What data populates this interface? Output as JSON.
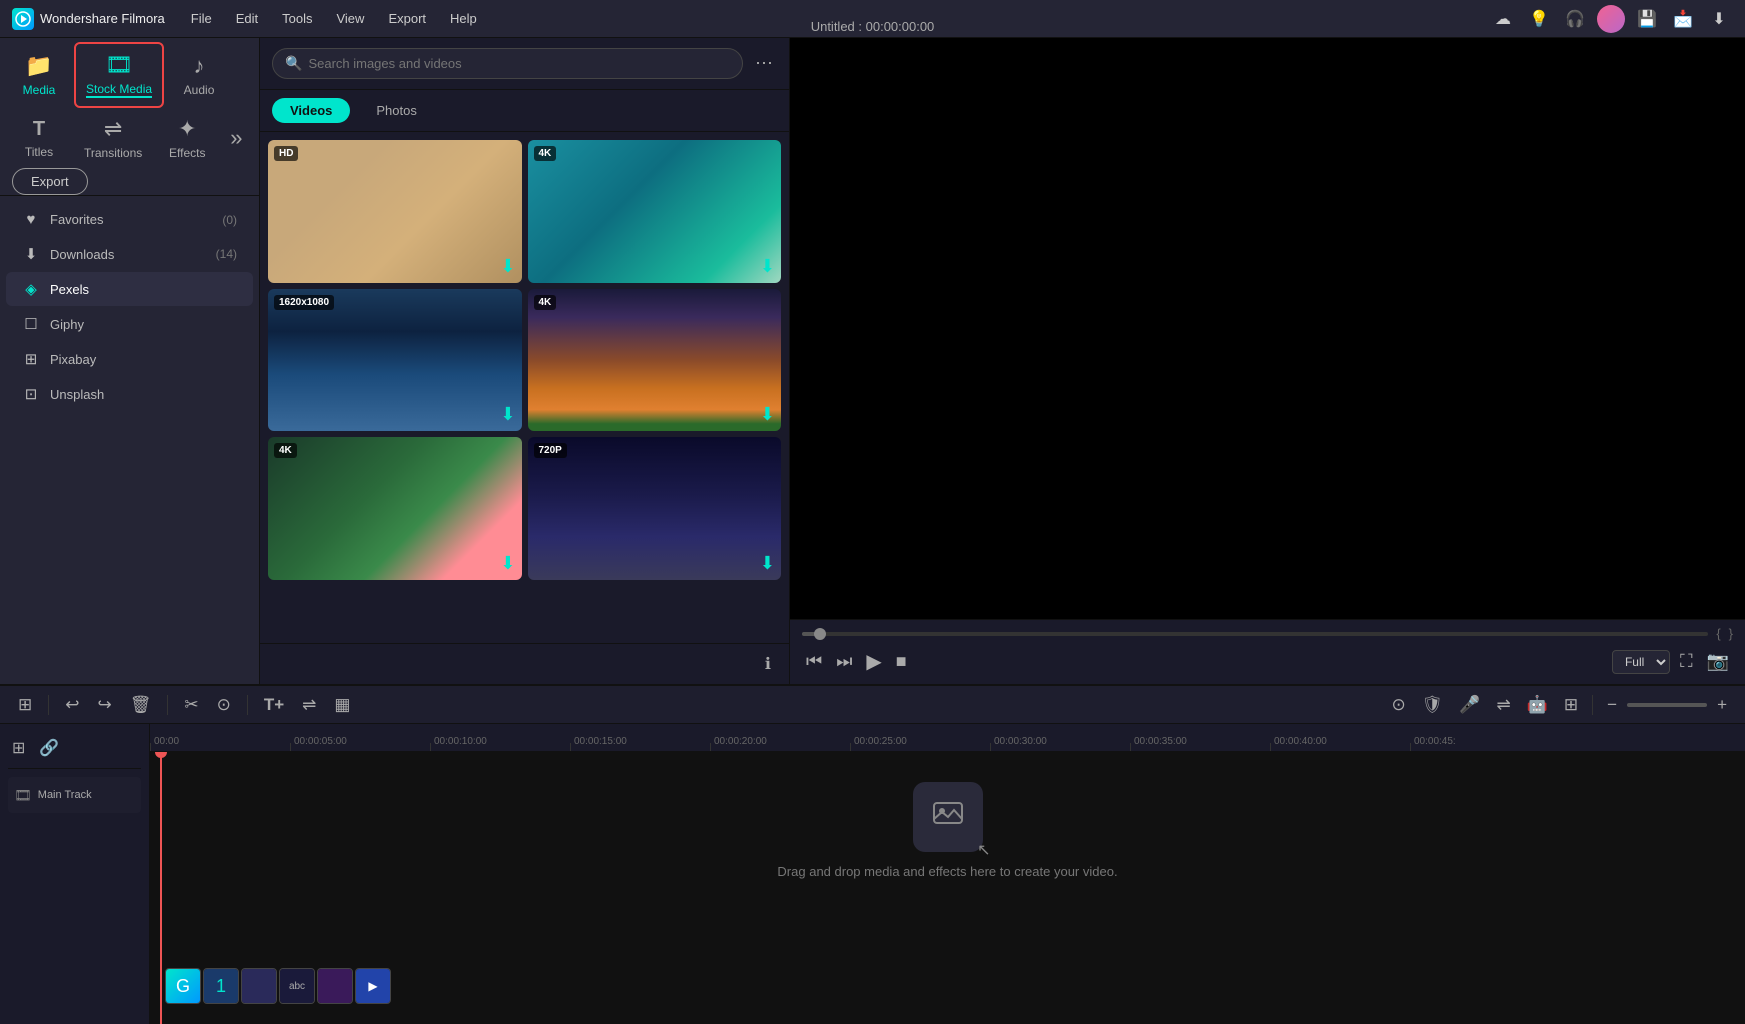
{
  "app": {
    "name": "Wondershare Filmora",
    "logo_text": "F",
    "title": "Untitled : 00:00:00:00"
  },
  "menu": {
    "items": [
      "File",
      "Edit",
      "Tools",
      "View",
      "Export",
      "Help"
    ]
  },
  "top_icons": [
    "☁",
    "💡",
    "🎧",
    "📩",
    "⬇"
  ],
  "nav_tabs": [
    {
      "id": "media",
      "label": "Media",
      "icon": "📁",
      "selected": false
    },
    {
      "id": "stock-media",
      "label": "Stock Media",
      "icon": "🎞",
      "selected": true,
      "active": true
    },
    {
      "id": "audio",
      "label": "Audio",
      "icon": "♪",
      "selected": false
    },
    {
      "id": "titles",
      "label": "Titles",
      "icon": "T",
      "selected": false
    },
    {
      "id": "transitions",
      "label": "Transitions",
      "icon": "⇌",
      "selected": false
    },
    {
      "id": "effects",
      "label": "Effects",
      "icon": "✦",
      "selected": false
    }
  ],
  "export_btn": "Export",
  "sidebar": {
    "items": [
      {
        "id": "favorites",
        "label": "Favorites",
        "icon": "♥",
        "count": "(0)",
        "active": false
      },
      {
        "id": "downloads",
        "label": "Downloads",
        "icon": "⬇",
        "count": "(14)",
        "active": false
      },
      {
        "id": "pexels",
        "label": "Pexels",
        "icon": "◈",
        "count": "",
        "active": true
      },
      {
        "id": "giphy",
        "label": "Giphy",
        "icon": "☐",
        "count": "",
        "active": false
      },
      {
        "id": "pixabay",
        "label": "Pixabay",
        "icon": "⊞",
        "count": "",
        "active": false
      },
      {
        "id": "unsplash",
        "label": "Unsplash",
        "icon": "⊡",
        "count": "",
        "active": false
      }
    ]
  },
  "search": {
    "placeholder": "Search images and videos"
  },
  "filter_tabs": [
    {
      "id": "videos",
      "label": "Videos",
      "active": true
    },
    {
      "id": "photos",
      "label": "Photos",
      "active": false
    }
  ],
  "videos": [
    {
      "id": 1,
      "badge": "HD",
      "bg_class": "thumb-seal"
    },
    {
      "id": 2,
      "badge": "4K",
      "bg_class": "thumb-ocean"
    },
    {
      "id": 3,
      "badge": "1620x1080",
      "bg_class": "thumb-mountain"
    },
    {
      "id": 4,
      "badge": "4K",
      "bg_class": "thumb-sunset"
    },
    {
      "id": 5,
      "badge": "4K",
      "bg_class": "thumb-forest"
    },
    {
      "id": 6,
      "badge": "720P",
      "bg_class": "thumb-stars"
    }
  ],
  "preview": {
    "quality": "Full",
    "controls": [
      "⏮",
      "⏭",
      "▶",
      "■"
    ]
  },
  "toolbar": {
    "buttons": [
      "⊞",
      "↩",
      "↪",
      "🗑",
      "✂",
      "⊙",
      "T+",
      "⇌",
      "▦"
    ]
  },
  "timeline": {
    "timestamps": [
      "00:00",
      "00:00:05:00",
      "00:00:10:00",
      "00:00:15:00",
      "00:00:20:00",
      "00:00:25:00",
      "00:00:30:00",
      "00:00:35:00",
      "00:00:40:00",
      "00:00:45:"
    ],
    "spacing": 140
  },
  "drop_zone": {
    "text": "Drag and drop media and effects here to create your video."
  }
}
